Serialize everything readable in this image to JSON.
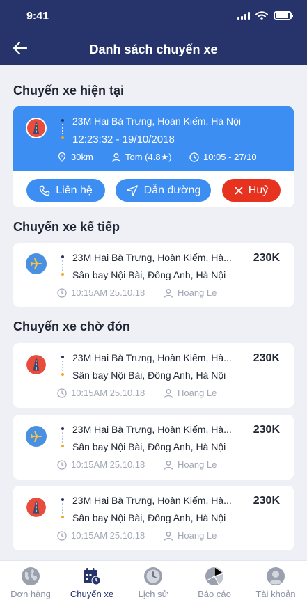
{
  "status_bar": {
    "time": "9:41"
  },
  "header": {
    "title": "Danh sách chuyến xe"
  },
  "sections": {
    "current": "Chuyến xe hiện tại",
    "next": "Chuyến xe kế tiếp",
    "waiting": "Chuyến xe chờ đón"
  },
  "current_trip": {
    "address": "23M Hai Bà Trưng, Hoàn Kiếm, Hà Nội",
    "datetime": "12:23:32 - 19/10/2018",
    "distance": "30km",
    "driver": "Tom (4.8★)",
    "time_range": "10:05 - 27/10",
    "buttons": {
      "contact": "Liên hệ",
      "directions": "Dẫn đường",
      "cancel": "Huỷ"
    }
  },
  "next_trip": {
    "from": "23M Hai Bà Trưng, Hoàn Kiếm, Hà...",
    "to": "Sân bay Nội Bài, Đông Anh, Hà Nội",
    "price": "230K",
    "time": "10:15AM 25.10.18",
    "person": "Hoang Le"
  },
  "waiting_trips": [
    {
      "from": "23M Hai Bà Trưng, Hoàn Kiếm, Hà...",
      "to": "Sân bay Nội Bài, Đông Anh, Hà Nội",
      "price": "230K",
      "time": "10:15AM 25.10.18",
      "person": "Hoang Le",
      "icon": "road-icon"
    },
    {
      "from": "23M Hai Bà Trưng, Hoàn Kiếm, Hà...",
      "to": "Sân bay Nội Bài, Đông Anh, Hà Nội",
      "price": "230K",
      "time": "10:15AM 25.10.18",
      "person": "Hoang Le",
      "icon": "airplane-icon"
    },
    {
      "from": "23M Hai Bà Trưng, Hoàn Kiếm, Hà...",
      "to": "Sân bay Nội Bài, Đông Anh, Hà Nội",
      "price": "230K",
      "time": "10:15AM 25.10.18",
      "person": "Hoang Le",
      "icon": "road-icon"
    }
  ],
  "tabbar": {
    "orders": "Đơn hàng",
    "trips": "Chuyến xe",
    "history": "Lịch sử",
    "reports": "Báo cáo",
    "account": "Tài khoản"
  },
  "colors": {
    "header": "#27346b",
    "primary": "#3d8ef2",
    "danger": "#e6321e",
    "origin_dot": "#27346b",
    "destination_dot": "#f5a623"
  }
}
